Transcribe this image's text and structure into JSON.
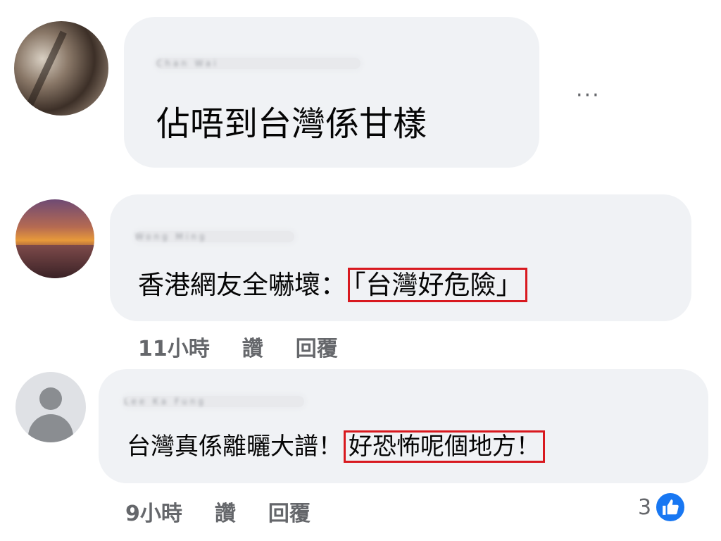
{
  "comments": [
    {
      "author": "Chan Wai",
      "text": "佔唔到台灣係甘樣",
      "more_label": "···"
    },
    {
      "author": "Wong Ming",
      "text_prefix": "香港網友全嚇壞：",
      "highlight": "「台灣好危險」",
      "time": "11小時",
      "like_label": "讚",
      "reply_label": "回覆"
    },
    {
      "author": "Lee Ka Fung",
      "text_prefix": "台灣真係離曬大譜！",
      "highlight": "好恐怖呢個地方！",
      "time": "9小時",
      "like_label": "讚",
      "reply_label": "回覆",
      "reaction_count": "3",
      "reaction_icon": "thumbs-up-icon"
    }
  ],
  "colors": {
    "bubble": "#f0f2f5",
    "meta_text": "#65676b",
    "highlight_border": "#d8191f",
    "like_blue": "#1877f2"
  }
}
